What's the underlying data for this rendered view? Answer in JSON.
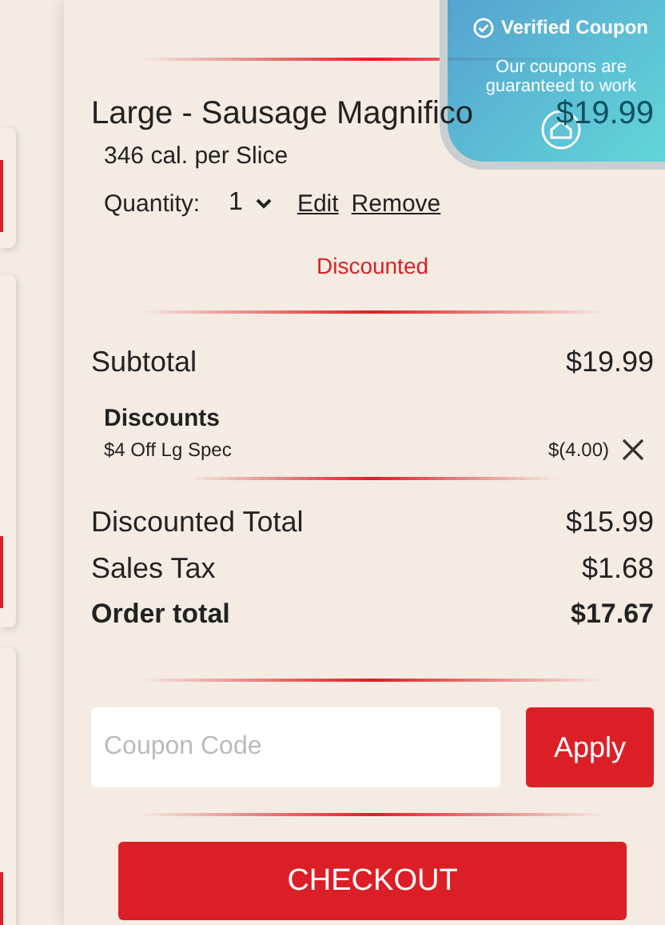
{
  "badge": {
    "title": "Verified Coupon",
    "text": "Our coupons are guaranteed to work"
  },
  "item": {
    "name": "Large - Sausage Magnifico",
    "price": "$19.99",
    "calories": "346 cal. per Slice",
    "quantity_label": "Quantity:",
    "quantity": "1",
    "links": [
      "Edit",
      "Remove"
    ],
    "status": "Discounted"
  },
  "subtotal": {
    "label": "Subtotal",
    "value": "$19.99"
  },
  "discounts": {
    "title": "Discounts",
    "items": [
      {
        "name": "$4 Off Lg Spec",
        "amount": "$(4.00)"
      }
    ]
  },
  "totals": [
    {
      "label": "Discounted Total",
      "value": "$15.99",
      "bold": false
    },
    {
      "label": "Sales Tax",
      "value": "$1.68",
      "bold": false
    },
    {
      "label": "Order total",
      "value": "$17.67",
      "bold": true
    }
  ],
  "coupon": {
    "placeholder": "Coupon Code",
    "button": "Apply"
  },
  "checkout": "CHECKOUT"
}
